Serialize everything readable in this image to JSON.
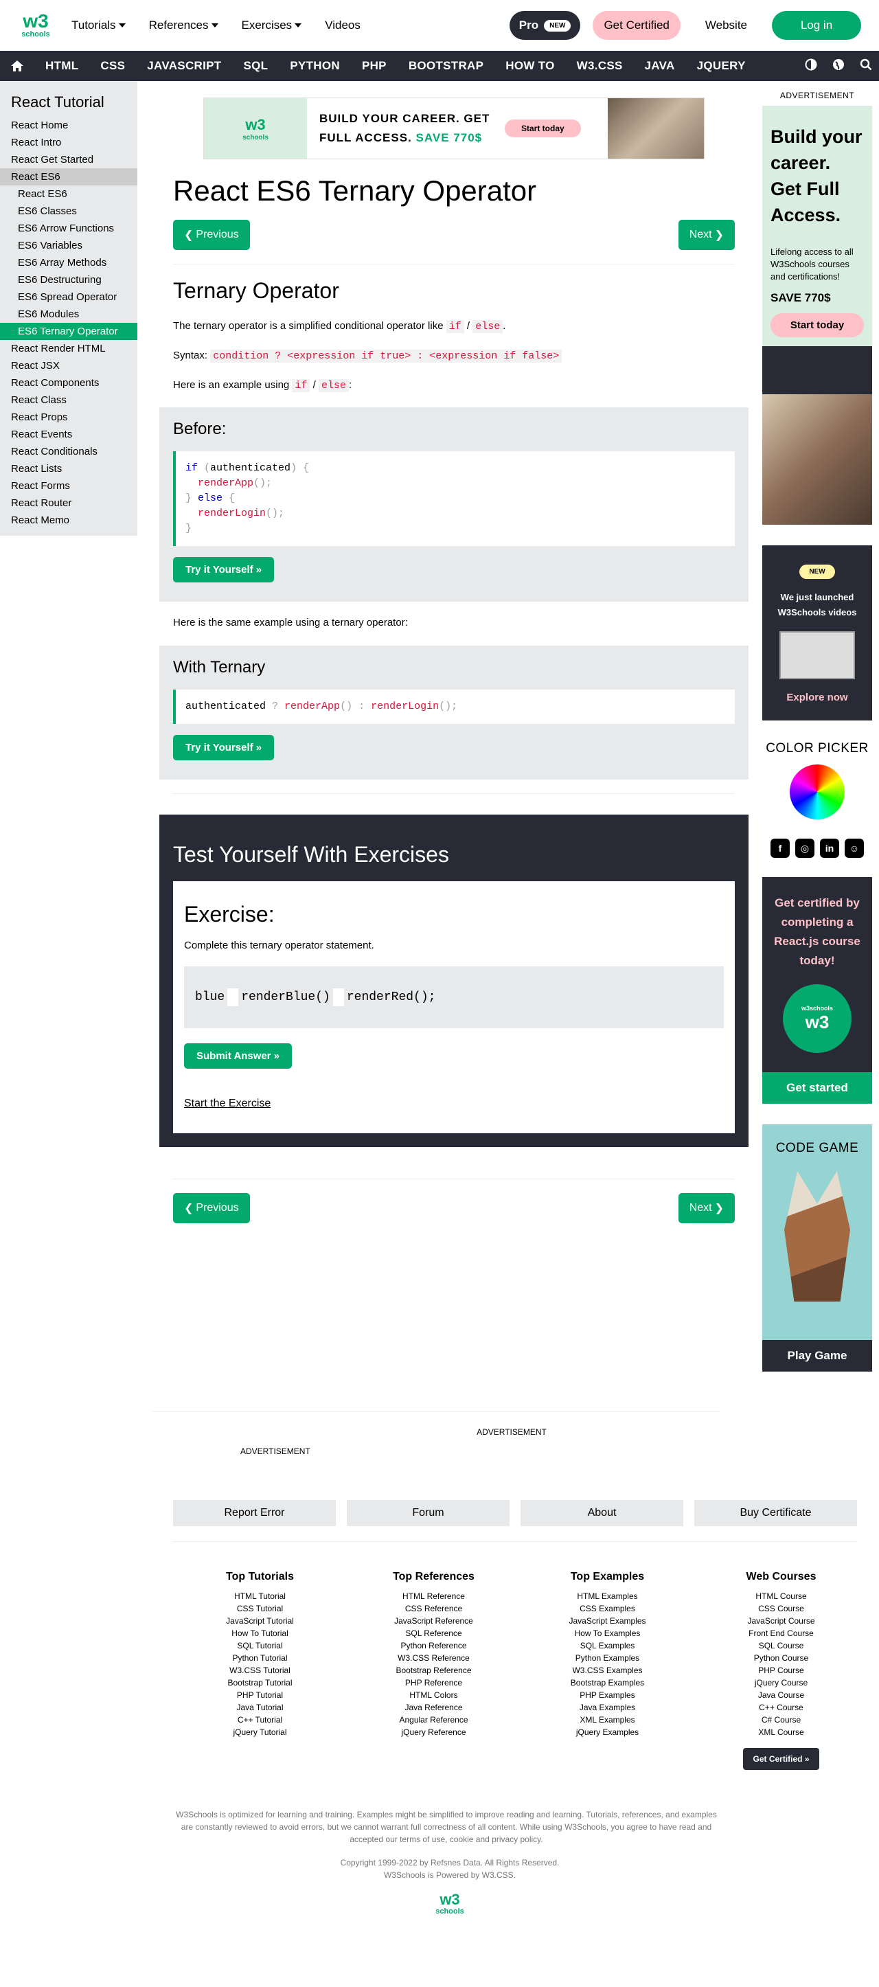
{
  "topbar": {
    "logo_text": "w3",
    "logo_sup": "3",
    "logo_sub": "schools",
    "menu": [
      "Tutorials",
      "References",
      "Exercises",
      "Videos"
    ],
    "pro_label": "Pro",
    "pro_badge": "NEW",
    "cert_label": "Get Certified",
    "website_label": "Website",
    "login_label": "Log in"
  },
  "navbar": {
    "links": [
      "HTML",
      "CSS",
      "JAVASCRIPT",
      "SQL",
      "PYTHON",
      "PHP",
      "BOOTSTRAP",
      "HOW TO",
      "W3.CSS",
      "JAVA",
      "JQUERY"
    ]
  },
  "sidebar": {
    "title": "React Tutorial",
    "items": [
      {
        "label": "React Home",
        "type": "item"
      },
      {
        "label": "React Intro",
        "type": "item"
      },
      {
        "label": "React Get Started",
        "type": "item"
      },
      {
        "label": "React ES6",
        "type": "section"
      },
      {
        "label": "React ES6",
        "type": "sub"
      },
      {
        "label": "ES6 Classes",
        "type": "sub"
      },
      {
        "label": "ES6 Arrow Functions",
        "type": "sub"
      },
      {
        "label": "ES6 Variables",
        "type": "sub"
      },
      {
        "label": "ES6 Array Methods",
        "type": "sub"
      },
      {
        "label": "ES6 Destructuring",
        "type": "sub"
      },
      {
        "label": "ES6 Spread Operator",
        "type": "sub"
      },
      {
        "label": "ES6 Modules",
        "type": "sub"
      },
      {
        "label": "ES6 Ternary Operator",
        "type": "active"
      },
      {
        "label": "React Render HTML",
        "type": "item"
      },
      {
        "label": "React JSX",
        "type": "item"
      },
      {
        "label": "React Components",
        "type": "item"
      },
      {
        "label": "React Class",
        "type": "item"
      },
      {
        "label": "React Props",
        "type": "item"
      },
      {
        "label": "React Events",
        "type": "item"
      },
      {
        "label": "React Conditionals",
        "type": "item"
      },
      {
        "label": "React Lists",
        "type": "item"
      },
      {
        "label": "React Forms",
        "type": "item"
      },
      {
        "label": "React Router",
        "type": "item"
      },
      {
        "label": "React Memo",
        "type": "item"
      }
    ]
  },
  "banner": {
    "line1": "BUILD YOUR CAREER. GET",
    "line2": "FULL ACCESS.",
    "save": "SAVE 770$",
    "button": "Start today"
  },
  "main": {
    "title": "React ES6 Ternary Operator",
    "prev": "Previous",
    "next": "Next",
    "section_title": "Ternary Operator",
    "intro_pre": "The ternary operator is a simplified conditional operator like ",
    "kw_if": "if",
    "slash": " / ",
    "kw_else": "else",
    "period": ".",
    "syntax_label": "Syntax: ",
    "syntax_code": "condition ? <expression if true> : <expression if false>",
    "example_pre": "Here is an example using ",
    "colon": ":",
    "before_title": "Before:",
    "try_label": "Try it Yourself »",
    "same_text": "Here is the same example using a ternary operator:",
    "with_title": "With Ternary",
    "exercises_title": "Test Yourself With Exercises",
    "exercise_heading": "Exercise:",
    "exercise_question": "Complete this ternary operator statement.",
    "ex_blue": "blue",
    "ex_render_blue": "renderBlue()",
    "ex_render_red": "renderRed();",
    "submit": "Submit Answer »",
    "start_exercise": "Start the Exercise"
  },
  "code_before": {
    "l1_kw": "if",
    "l1_a": " (",
    "l1_var": "authenticated",
    "l1_b": ") {",
    "l2_fn": "renderApp",
    "l2_a": "();",
    "l3_a": "} ",
    "l3_kw": "else",
    "l3_b": " {",
    "l4_fn": "renderLogin",
    "l4_a": "();",
    "l5": "}"
  },
  "code_with": {
    "var": "authenticated",
    "q": " ? ",
    "fn1": "renderApp",
    "p1": "()",
    "c": " : ",
    "fn2": "renderLogin",
    "p2": "();"
  },
  "right": {
    "ad_label": "ADVERTISEMENT",
    "ad1_big": "Build your career. Get Full Access.",
    "ad1_small": "Lifelong access to all W3Schools courses and certifications!",
    "ad1_save": "SAVE 770$",
    "ad1_btn": "Start today",
    "ad2_badge": "NEW",
    "ad2_text": "We just launched W3Schools videos",
    "ad2_link": "Explore now",
    "picker": "COLOR PICKER",
    "ad3_text": "Get certified by completing a React.js course today!",
    "ad3_badge": "w3schools",
    "ad3_btn": "Get started",
    "ad4_title": "CODE GAME",
    "ad4_btn": "Play Game"
  },
  "footer": {
    "ad_center": "ADVERTISEMENT",
    "ad_left": "ADVERTISEMENT",
    "buttons": [
      "Report Error",
      "Forum",
      "About",
      "Buy Certificate"
    ],
    "cols": [
      {
        "title": "Top Tutorials",
        "links": [
          "HTML Tutorial",
          "CSS Tutorial",
          "JavaScript Tutorial",
          "How To Tutorial",
          "SQL Tutorial",
          "Python Tutorial",
          "W3.CSS Tutorial",
          "Bootstrap Tutorial",
          "PHP Tutorial",
          "Java Tutorial",
          "C++ Tutorial",
          "jQuery Tutorial"
        ]
      },
      {
        "title": "Top References",
        "links": [
          "HTML Reference",
          "CSS Reference",
          "JavaScript Reference",
          "SQL Reference",
          "Python Reference",
          "W3.CSS Reference",
          "Bootstrap Reference",
          "PHP Reference",
          "HTML Colors",
          "Java Reference",
          "Angular Reference",
          "jQuery Reference"
        ]
      },
      {
        "title": "Top Examples",
        "links": [
          "HTML Examples",
          "CSS Examples",
          "JavaScript Examples",
          "How To Examples",
          "SQL Examples",
          "Python Examples",
          "W3.CSS Examples",
          "Bootstrap Examples",
          "PHP Examples",
          "Java Examples",
          "XML Examples",
          "jQuery Examples"
        ]
      },
      {
        "title": "Web Courses",
        "links": [
          "HTML Course",
          "CSS Course",
          "JavaScript Course",
          "Front End Course",
          "SQL Course",
          "Python Course",
          "PHP Course",
          "jQuery Course",
          "Java Course",
          "C++ Course",
          "C# Course",
          "XML Course"
        ]
      }
    ],
    "get_certified": "Get Certified »",
    "disclaimer": "W3Schools is optimized for learning and training. Examples might be simplified to improve reading and learning. Tutorials, references, and examples are constantly reviewed to avoid errors, but we cannot warrant full correctness of all content. While using W3Schools, you agree to have read and accepted our terms of use, cookie and privacy policy.",
    "copyright": "Copyright 1999-2022 by Refsnes Data. All Rights Reserved.",
    "powered": "W3Schools is Powered by W3.CSS."
  }
}
